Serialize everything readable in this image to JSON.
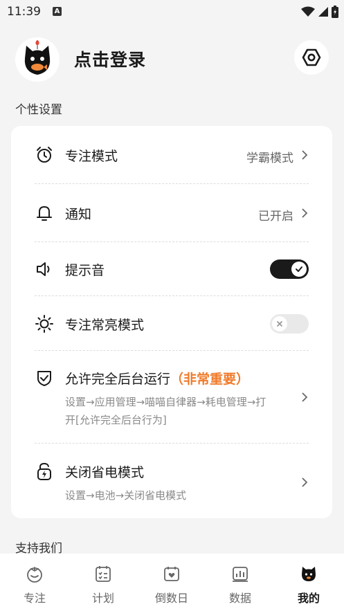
{
  "status_bar": {
    "time": "11:39",
    "notification_letter": "A"
  },
  "header": {
    "login_text": "点击登录"
  },
  "sections": {
    "personal": "个性设置",
    "support": "支持我们"
  },
  "settings": {
    "focus_mode": {
      "label": "专注模式",
      "value": "学霸模式"
    },
    "notification": {
      "label": "通知",
      "value": "已开启"
    },
    "sound": {
      "label": "提示音",
      "toggle_on": true
    },
    "screen_on": {
      "label": "专注常亮模式",
      "toggle_on": false
    },
    "background_run": {
      "label": "允许完全后台运行",
      "label_accent": "（非常重要）",
      "sub": "设置→应用管理→喵喵自律器→耗电管理→打开[允许完全后台行为]"
    },
    "power_saving": {
      "label": "关闭省电模式",
      "sub": "设置→电池→关闭省电模式"
    }
  },
  "tabbar": {
    "items": [
      {
        "label": "专注",
        "icon": "tomato-icon"
      },
      {
        "label": "计划",
        "icon": "checklist-icon"
      },
      {
        "label": "倒数日",
        "icon": "calendar-heart-icon"
      },
      {
        "label": "数据",
        "icon": "bar-chart-icon"
      },
      {
        "label": "我的",
        "icon": "cat-icon",
        "active": true
      }
    ]
  },
  "colors": {
    "accent": "#f07a2a",
    "toggle_on": "#1a1a1a",
    "background": "#f4f4f4"
  }
}
